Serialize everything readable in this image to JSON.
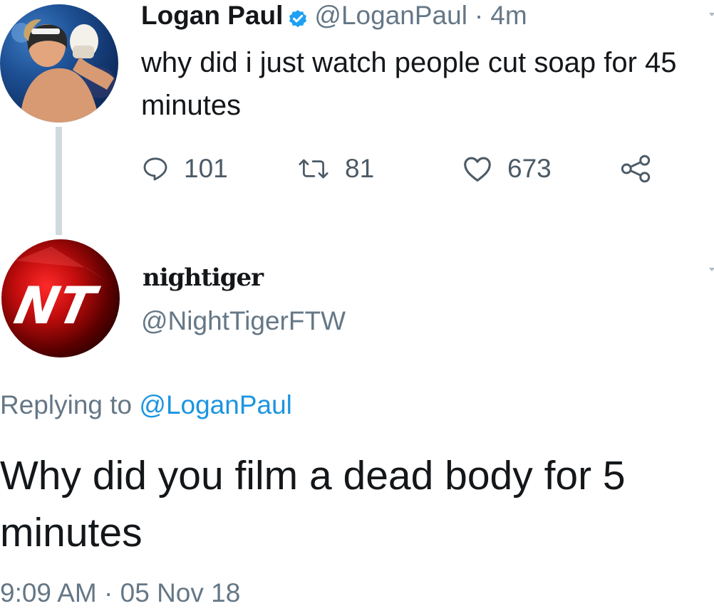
{
  "tweet": {
    "display_name": "Logan Paul",
    "handle": "@LoganPaul",
    "separator": "·",
    "time": "4m",
    "text": "why did i just watch people cut soap for 45 minutes",
    "actions": {
      "reply_count": "101",
      "retweet_count": "81",
      "like_count": "673"
    }
  },
  "reply": {
    "display_name": "nightiger",
    "avatar_text": "NT",
    "handle": "@NightTigerFTW",
    "replying_prefix": "Replying to",
    "replying_mention": "@LoganPaul",
    "text": "Why did you film a dead body for 5 minutes",
    "timestamp": "9:09 AM · 05 Nov 18"
  },
  "colors": {
    "text_primary": "#14171a",
    "text_secondary": "#657786",
    "link": "#1b95e0",
    "verified_badge": "#1da1f2",
    "thread_line": "#cfd9de"
  },
  "icons": {
    "reply": "speech-bubble-icon",
    "retweet": "retweet-arrows-icon",
    "like": "heart-outline-icon",
    "share": "share-nodes-icon",
    "verified": "verified-badge-icon",
    "caret": "chevron-down-icon"
  }
}
